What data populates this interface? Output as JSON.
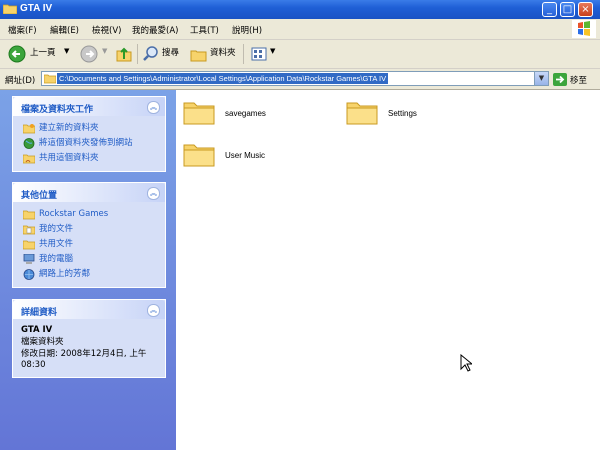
{
  "window": {
    "title": "GTA IV"
  },
  "menu": [
    "檔案(F)",
    "編輯(E)",
    "檢視(V)",
    "我的最愛(A)",
    "工具(T)",
    "說明(H)"
  ],
  "toolbar": {
    "back": "上一頁",
    "search": "搜尋",
    "folders": "資料夾"
  },
  "address": {
    "label": "網址(D)",
    "path": "C:\\Documents and Settings\\Administrator\\Local Settings\\Application Data\\Rockstar Games\\GTA IV",
    "go": "移至"
  },
  "tasks": {
    "title": "檔案及資料夾工作",
    "items": [
      "建立新的資料夾",
      "將這個資料夾發佈到網站",
      "共用這個資料夾"
    ]
  },
  "places": {
    "title": "其他位置",
    "items": [
      "Rockstar Games",
      "我的文件",
      "共用文件",
      "我的電腦",
      "網路上的芳鄰"
    ]
  },
  "details": {
    "title": "詳細資料",
    "name": "GTA IV",
    "type": "檔案資料夾",
    "modified": "修改日期: 2008年12月4日, 上午 08:30"
  },
  "files": [
    "savegames",
    "Settings",
    "User Music"
  ]
}
